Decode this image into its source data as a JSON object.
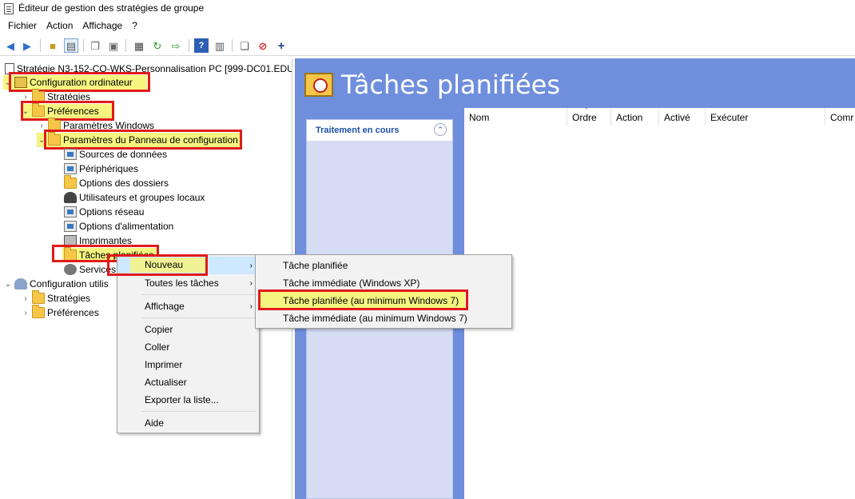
{
  "window": {
    "title": "Éditeur de gestion des stratégies de groupe"
  },
  "menubar": [
    "Fichier",
    "Action",
    "Affichage",
    "?"
  ],
  "toolbar": {
    "icons": [
      "back-arrow-icon",
      "forward-arrow-icon",
      "up-folder-icon",
      "show-hide-tree-icon",
      "copy-icon",
      "paste-icon",
      "print-icon",
      "refresh-icon",
      "export-icon",
      "help-icon",
      "properties-icon",
      "new-item-icon",
      "delete-icon",
      "add-icon"
    ]
  },
  "tree": {
    "root": "Stratégie N3-152-CO-WKS-Personnalisation PC [999-DC01.EDU.H",
    "computer_config": "Configuration ordinateur",
    "strategies": "Stratégies",
    "preferences": "Préférences",
    "windows_settings": "Paramètres Windows",
    "control_panel": "Paramètres du Panneau de configuration",
    "control_panel_items": [
      "Sources de données",
      "Périphériques",
      "Options des dossiers",
      "Utilisateurs et groupes locaux",
      "Options réseau",
      "Options d'alimentation",
      "Imprimantes",
      "Tâches planifiées",
      "Services"
    ],
    "user_config": "Configuration utilis",
    "user_strategies": "Stratégies",
    "user_preferences": "Préférences"
  },
  "context_menu": {
    "items": [
      "Nouveau",
      "Toutes les tâches",
      "Affichage",
      "Copier",
      "Coller",
      "Imprimer",
      "Actualiser",
      "Exporter la liste...",
      "Aide"
    ]
  },
  "submenu": {
    "items": [
      "Tâche planifiée",
      "Tâche immédiate (Windows XP)",
      "Tâche planifiée (au minimum Windows 7)",
      "Tâche immédiate (au minimum Windows 7)"
    ]
  },
  "right_pane": {
    "title": "Tâches planifiées",
    "side_panel_title": "Traitement en cours",
    "columns": [
      "Nom",
      "Ordre",
      "Action",
      "Activé",
      "Exécuter",
      "Comr"
    ]
  },
  "colors": {
    "highlight_border": "#e01b1b",
    "highlight_fill": "#f5f580",
    "pane_blue": "#6f8fdd",
    "link_blue": "#1c4fa8"
  }
}
